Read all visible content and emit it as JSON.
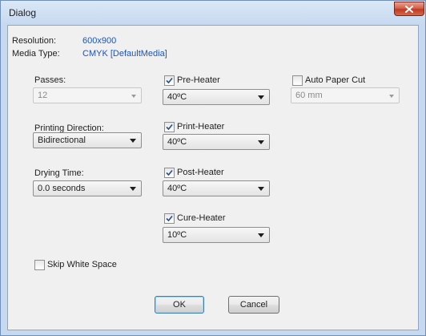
{
  "window": {
    "title": "Dialog"
  },
  "info": {
    "resolution_label": "Resolution:",
    "resolution_value": "600x900",
    "media_type_label": "Media Type:",
    "media_type_value": "CMYK [DefaultMedia]"
  },
  "passes": {
    "label": "Passes:",
    "value": "12",
    "enabled": false
  },
  "printing_direction": {
    "label": "Printing Direction:",
    "value": "Bidirectional"
  },
  "drying_time": {
    "label": "Drying Time:",
    "value": "0.0 seconds"
  },
  "pre_heater": {
    "label": "Pre-Heater",
    "checked": true,
    "value": "40ºC"
  },
  "print_heater": {
    "label": "Print-Heater",
    "checked": true,
    "value": "40ºC"
  },
  "post_heater": {
    "label": "Post-Heater",
    "checked": true,
    "value": "40ºC"
  },
  "cure_heater": {
    "label": "Cure-Heater",
    "checked": true,
    "value": "10ºC"
  },
  "auto_paper_cut": {
    "label": "Auto Paper Cut",
    "checked": false,
    "value": "60 mm",
    "enabled": false
  },
  "skip_white_space": {
    "label": "Skip White Space",
    "checked": false
  },
  "buttons": {
    "ok": "OK",
    "cancel": "Cancel"
  },
  "colors": {
    "value_text": "#1b56b8",
    "close_button": "#c13a22",
    "frame": "#c6d9ef"
  }
}
